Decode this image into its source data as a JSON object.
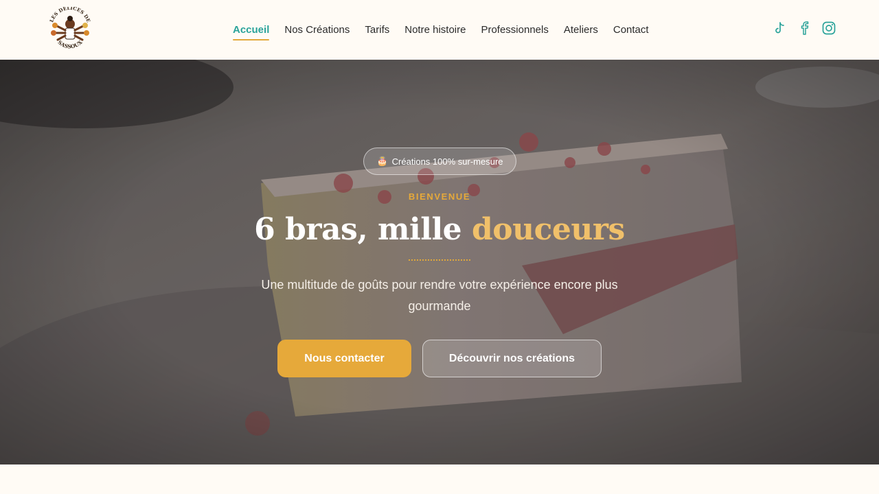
{
  "header": {
    "logo_text_top": "LES DÉLICES DE",
    "logo_text_bottom": "SASSOUX",
    "nav": [
      {
        "label": "Accueil",
        "active": true
      },
      {
        "label": "Nos Créations",
        "active": false
      },
      {
        "label": "Tarifs",
        "active": false
      },
      {
        "label": "Notre histoire",
        "active": false
      },
      {
        "label": "Professionnels",
        "active": false
      },
      {
        "label": "Ateliers",
        "active": false
      },
      {
        "label": "Contact",
        "active": false
      }
    ],
    "socials": [
      "tiktok-icon",
      "facebook-icon",
      "instagram-icon"
    ]
  },
  "hero": {
    "badge_emoji": "🎂",
    "badge_text": "Créations 100% sur-mesure",
    "eyebrow": "BIENVENUE",
    "title_main": "6 bras, mille",
    "title_accent": "douceurs",
    "subtitle": "Une multitude de goûts pour rendre votre expérience encore plus gourmande",
    "primary_button": "Nous contacter",
    "secondary_button": "Découvrir nos créations"
  },
  "colors": {
    "teal": "#2aa39a",
    "gold": "#e6a93a",
    "cream": "#fffbf5"
  }
}
